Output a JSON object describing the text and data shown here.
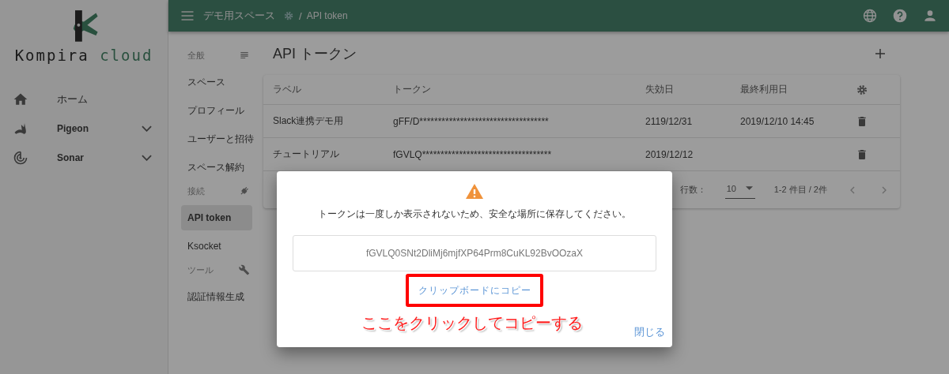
{
  "sidebar": {
    "logo": {
      "word_1": "Kompira",
      "word_2": "cloud"
    },
    "items": [
      {
        "kind": "link",
        "label": "ホーム"
      },
      {
        "kind": "group",
        "label": "Pigeon",
        "expanded": false
      },
      {
        "kind": "group",
        "label": "Sonar",
        "expanded": false
      }
    ]
  },
  "header": {
    "breadcrumb": {
      "space": "デモ用スペース",
      "separator": "/",
      "page": "API token"
    }
  },
  "settings_nav": [
    {
      "kind": "section",
      "label": "全般"
    },
    {
      "kind": "item",
      "label": "スペース",
      "selected": false
    },
    {
      "kind": "item",
      "label": "プロフィール",
      "selected": false
    },
    {
      "kind": "item",
      "label": "ユーザーと招待",
      "selected": false
    },
    {
      "kind": "item",
      "label": "スペース解約",
      "selected": false
    },
    {
      "kind": "section",
      "label": "接続"
    },
    {
      "kind": "item",
      "label": "API token",
      "selected": true
    },
    {
      "kind": "item",
      "label": "Ksocket",
      "selected": false
    },
    {
      "kind": "section",
      "label": "ツール"
    },
    {
      "kind": "item",
      "label": "認証情報生成",
      "selected": false
    }
  ],
  "page": {
    "title": "API トークン"
  },
  "table": {
    "columns": [
      "ラベル",
      "トークン",
      "失効日",
      "最終利用日"
    ],
    "rows": [
      {
        "label": "Slack連携デモ用",
        "token": "gFF/D***********************************",
        "expires": "2119/12/31",
        "last_used": "2019/12/10 14:45"
      },
      {
        "label": "チュートリアル",
        "token": "fGVLQ***********************************",
        "expires": "2019/12/12"
      }
    ],
    "footer": {
      "rows_label": "行数：",
      "rows_per_page": "10",
      "range": "1-2 件目 / 2件"
    }
  },
  "dialog": {
    "message": "トークンは一度しか表示されないため、安全な場所に保存してください。",
    "token": "fGVLQ0SNt2DliMj6mjfXP64Prm8CuKL92BvOOzaX",
    "copy_button": "クリップボードにコピー",
    "close_button": "閉じる"
  },
  "annotation": {
    "text": "ここをクリックしてコピーする"
  }
}
